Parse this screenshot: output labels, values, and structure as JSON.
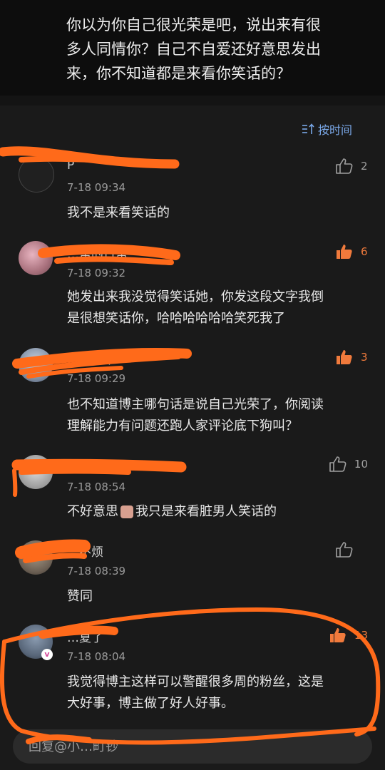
{
  "quote": {
    "line1": "你以为你自己很光荣是吧，说出来有很",
    "line2": "多人同情你？自己不自爱还好意思发出",
    "line3": "来，你不知道都是来看你笑话的？"
  },
  "sort": {
    "label": "按时间",
    "icon": "sort-icon"
  },
  "comments": [
    {
      "username": "P",
      "time": "7-18 09:34",
      "text_lines": [
        "我不是来看笑话的"
      ],
      "likes": "2",
      "liked": false
    },
    {
      "username": "…常的日常",
      "time": "7-18 09:32",
      "text_lines": [
        "她发出来我没觉得笑话她，你发这段文字我倒",
        "是很想笑话你，哈哈哈哈哈哈笑死我了"
      ],
      "likes": "6",
      "liked": true
    },
    {
      "username": "…司要乖",
      "time": "7-18 09:29",
      "text_lines": [
        "也不知道博主哪句话是说自己光荣了，你阅读",
        "理解能力有问题还跑人家评论底下狗叫？"
      ],
      "likes": "3",
      "liked": true
    },
    {
      "username": "",
      "time": "7-18 08:54",
      "text_lines": [
        "不好意思",
        "我只是来看脏男人笑话的"
      ],
      "likes": "10",
      "liked": false
    },
    {
      "username": "…不烦",
      "time": "7-18 08:39",
      "text_lines": [
        "赞同"
      ],
      "likes": "",
      "liked": false
    },
    {
      "username": "…夏了",
      "time": "7-18 08:04",
      "text_lines": [
        "我觉得博主这样可以警醒很多周的粉丝，这是",
        "大好事，博主做了好人好事。"
      ],
      "likes": "13",
      "liked": true,
      "vip": "v"
    }
  ],
  "reply": {
    "placeholder": "回复@小…町钞"
  },
  "colors": {
    "accent_blue": "#7aa8e8",
    "liked_orange": "#f07a3c",
    "scribble_orange": "#ff6a1a"
  }
}
